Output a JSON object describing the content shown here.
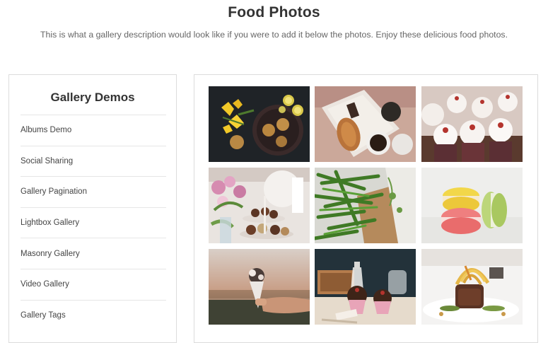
{
  "header": {
    "title": "Food Photos",
    "description": "This is what a gallery description would look like if you were to add it below the photos. Enjoy these delicious food photos."
  },
  "sidebar": {
    "title": "Gallery Demos",
    "items": [
      {
        "label": "Albums Demo"
      },
      {
        "label": "Social Sharing"
      },
      {
        "label": "Gallery Pagination"
      },
      {
        "label": "Lightbox Gallery"
      },
      {
        "label": "Masonry Gallery"
      },
      {
        "label": "Video Gallery"
      },
      {
        "label": "Gallery Tags"
      }
    ]
  },
  "gallery": {
    "photos": [
      {
        "name": "cookies-and-lemons-photo"
      },
      {
        "name": "croissant-and-coffee-photo"
      },
      {
        "name": "cupcakes-photo"
      },
      {
        "name": "flowers-and-dessert-stand-photo"
      },
      {
        "name": "green-beans-photo"
      },
      {
        "name": "macarons-photo"
      },
      {
        "name": "ice-cream-cone-photo"
      },
      {
        "name": "chocolate-cupcakes-photo"
      },
      {
        "name": "plated-dish-photo"
      }
    ]
  },
  "colors": {
    "border": "#dcdcdc",
    "title_text": "#333333",
    "body_text": "#666666"
  }
}
